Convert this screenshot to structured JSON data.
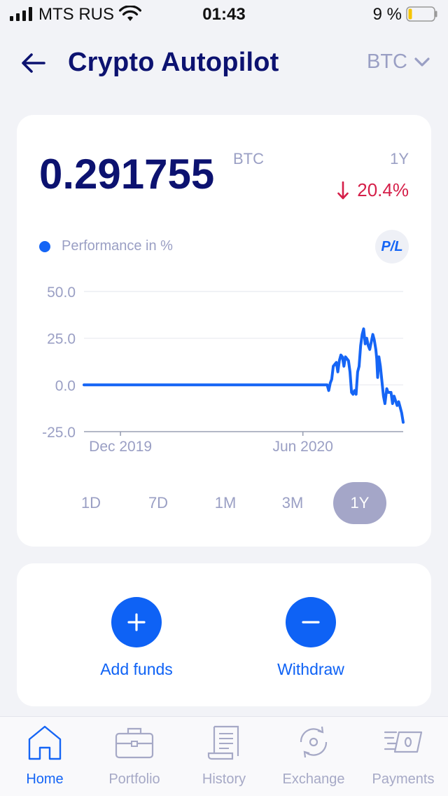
{
  "status_bar": {
    "carrier": "MTS RUS",
    "time": "01:43",
    "battery": "9 %"
  },
  "header": {
    "title": "Crypto Autopilot",
    "currency": "BTC"
  },
  "balance": {
    "value": "0.291755",
    "unit": "BTC",
    "period": "1Y",
    "change": "20.4%",
    "change_direction": "down"
  },
  "legend": {
    "label": "Performance in %",
    "pl_button": "P/L"
  },
  "chart_data": {
    "type": "line",
    "series": [
      {
        "name": "Performance in %",
        "color": "#1565f5",
        "points": [
          [
            0,
            0
          ],
          [
            0.2,
            0
          ],
          [
            0.4,
            0
          ],
          [
            0.6,
            0
          ],
          [
            0.7,
            0
          ],
          [
            0.76,
            0
          ],
          [
            0.8,
            0
          ],
          [
            0.805,
            -3
          ],
          [
            0.81,
            1
          ],
          [
            0.815,
            3
          ],
          [
            0.82,
            10
          ],
          [
            0.83,
            12
          ],
          [
            0.835,
            7
          ],
          [
            0.84,
            13
          ],
          [
            0.845,
            16
          ],
          [
            0.85,
            15
          ],
          [
            0.855,
            10
          ],
          [
            0.86,
            15
          ],
          [
            0.87,
            13
          ],
          [
            0.875,
            7
          ],
          [
            0.88,
            -4
          ],
          [
            0.885,
            -5
          ],
          [
            0.89,
            -3
          ],
          [
            0.895,
            -5
          ],
          [
            0.9,
            7
          ],
          [
            0.905,
            10
          ],
          [
            0.91,
            21
          ],
          [
            0.915,
            27
          ],
          [
            0.92,
            30
          ],
          [
            0.925,
            22
          ],
          [
            0.93,
            25
          ],
          [
            0.935,
            21
          ],
          [
            0.94,
            19
          ],
          [
            0.945,
            23
          ],
          [
            0.95,
            27
          ],
          [
            0.955,
            24
          ],
          [
            0.96,
            19
          ],
          [
            0.963,
            14
          ],
          [
            0.966,
            4
          ],
          [
            0.97,
            15
          ],
          [
            0.975,
            10
          ],
          [
            0.98,
            2
          ],
          [
            0.985,
            -6
          ],
          [
            0.99,
            -10
          ],
          [
            0.993,
            -6
          ],
          [
            0.996,
            -2
          ],
          [
            1.0,
            -4
          ],
          [
            1.01,
            -4
          ],
          [
            1.015,
            -10
          ],
          [
            1.02,
            -6
          ],
          [
            1.03,
            -11
          ],
          [
            1.035,
            -9
          ],
          [
            1.04,
            -12
          ],
          [
            1.045,
            -15
          ],
          [
            1.05,
            -20
          ]
        ]
      }
    ],
    "x_ticks": [
      "Dec 2019",
      "Jun 2020"
    ],
    "y_ticks": [
      "50.0",
      "25.0",
      "0.0",
      "-25.0"
    ],
    "ylim": [
      -25,
      50
    ],
    "grid": true
  },
  "periods": {
    "items": [
      "1D",
      "7D",
      "1M",
      "3M",
      "1Y"
    ],
    "active": "1Y"
  },
  "actions": {
    "add_funds": "Add funds",
    "withdraw": "Withdraw"
  },
  "tabbar": {
    "items": [
      "Home",
      "Portfolio",
      "History",
      "Exchange",
      "Payments"
    ],
    "active": "Home"
  },
  "colors": {
    "accent": "#1565f5",
    "negative": "#d51f49",
    "title": "#0c1270",
    "muted": "#9a9fc4"
  }
}
